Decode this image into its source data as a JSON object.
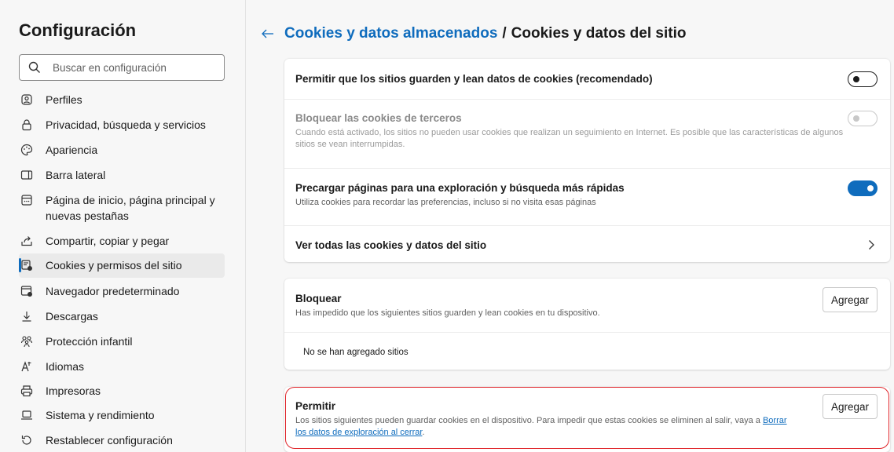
{
  "sidebar": {
    "title": "Configuración",
    "search_placeholder": "Buscar en configuración",
    "items": [
      {
        "label": "Perfiles",
        "icon": "profile-icon"
      },
      {
        "label": "Privacidad, búsqueda y servicios",
        "icon": "lock-icon"
      },
      {
        "label": "Apariencia",
        "icon": "palette-icon"
      },
      {
        "label": "Barra lateral",
        "icon": "sidebar-icon"
      },
      {
        "label": "Página de inicio, página principal y nuevas pestañas",
        "icon": "home-tabs-icon"
      },
      {
        "label": "Compartir, copiar y pegar",
        "icon": "share-icon"
      },
      {
        "label": "Cookies y permisos del sitio",
        "icon": "cookies-permissions-icon",
        "active": true
      },
      {
        "label": "Navegador predeterminado",
        "icon": "default-browser-icon"
      },
      {
        "label": "Descargas",
        "icon": "download-icon"
      },
      {
        "label": "Protección infantil",
        "icon": "family-icon"
      },
      {
        "label": "Idiomas",
        "icon": "language-icon"
      },
      {
        "label": "Impresoras",
        "icon": "printer-icon"
      },
      {
        "label": "Sistema y rendimiento",
        "icon": "laptop-icon"
      },
      {
        "label": "Restablecer configuración",
        "icon": "reset-icon"
      }
    ]
  },
  "header": {
    "parent": "Cookies y datos almacenados",
    "separator": "/",
    "current": "Cookies y datos del sitio"
  },
  "settings": {
    "allow_cookies": {
      "title": "Permitir que los sitios guarden y lean datos de cookies (recomendado)",
      "enabled": false
    },
    "block_third_party": {
      "title": "Bloquear las cookies de terceros",
      "desc": "Cuando está activado, los sitios no pueden usar cookies que realizan un seguimiento en Internet. Es posible que las características de algunos sitios se vean interrumpidas.",
      "enabled": false
    },
    "preload": {
      "title": "Precargar páginas para una exploración y búsqueda más rápidas",
      "desc": "Utiliza cookies para recordar las preferencias, incluso si no visita esas páginas",
      "enabled": true
    },
    "see_all": {
      "title": "Ver todas las cookies y datos del sitio"
    }
  },
  "block": {
    "title": "Bloquear",
    "desc": "Has impedido que los siguientes sitios guarden y lean cookies en tu dispositivo.",
    "button": "Agregar",
    "empty": "No se han agregado sitios"
  },
  "allow": {
    "title": "Permitir",
    "desc_before": "Los sitios siguientes pueden guardar cookies en el dispositivo. Para impedir que estas cookies se eliminen al salir, vaya a ",
    "link_line1": "Borrar",
    "link_line2": "los datos de exploración al cerrar",
    "desc_after": ".",
    "button": "Agregar"
  },
  "colors": {
    "accent": "#0f6cbd",
    "highlight": "#e0242a"
  }
}
